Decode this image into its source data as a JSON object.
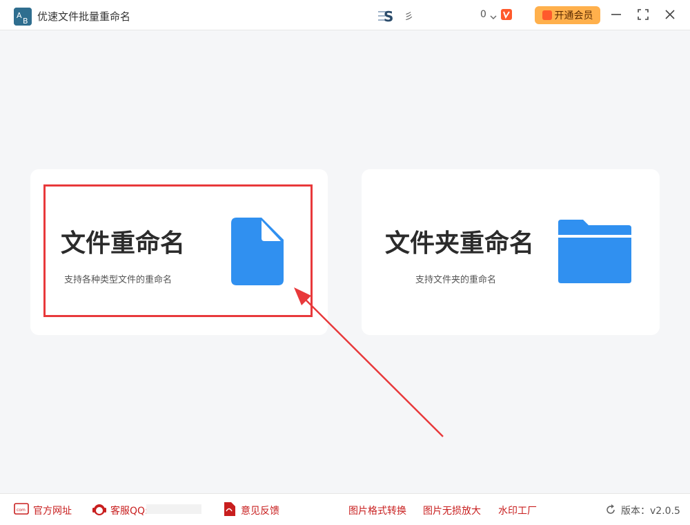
{
  "app": {
    "title": "优速文件批量重命名"
  },
  "header": {
    "user_name": "彡",
    "coins": "0",
    "vip_button_label": "开通会员"
  },
  "cards": [
    {
      "title": "文件重命名",
      "subtitle": "支持各种类型文件的重命名",
      "icon": "file-icon",
      "color": "#3090f0"
    },
    {
      "title": "文件夹重命名",
      "subtitle": "支持文件夹的重命名",
      "icon": "folder-icon",
      "color": "#3090f0"
    }
  ],
  "footer": {
    "website": "官方网址",
    "support_qq": "客服QQ:",
    "feedback": "意见反馈",
    "links": [
      "图片格式转换",
      "图片无损放大",
      "水印工厂"
    ],
    "version": "版本：v2.0.5"
  },
  "colors": {
    "accent": "#3090f0",
    "highlight": "#e8393b",
    "vip": "#ffb04c",
    "link": "#c81e1e"
  }
}
